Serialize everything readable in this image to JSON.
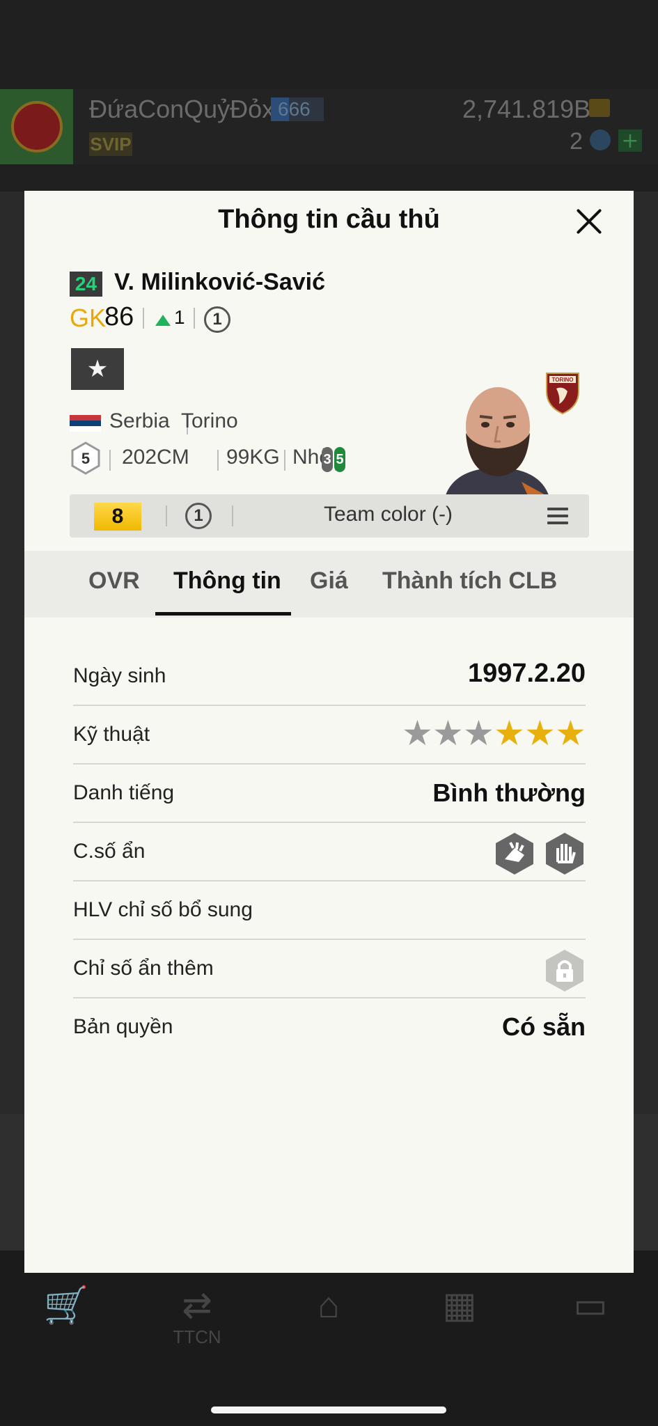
{
  "background": {
    "user_name": "ĐứaConQuỷĐỏx",
    "level": "666",
    "vip": "SVIP",
    "money": "2,741.819B",
    "coins": "2",
    "plus": "+",
    "nav_label": "TTCN"
  },
  "modal": {
    "title": "Thông tin cầu thủ",
    "player": {
      "number": "24",
      "name": "V. Milinković-Savić",
      "position": "GK",
      "ovr": "86",
      "change": "1",
      "circle": "1",
      "fav_icon": "★",
      "nation": "Serbia",
      "club": "Torino",
      "weak_foot": "5",
      "height": "202CM",
      "weight": "99KG",
      "body": "Nhỏ",
      "foot_left": "3",
      "foot_right": "5"
    },
    "action_bar": {
      "level": "8",
      "circle": "1",
      "team_color": "Team color (-)"
    },
    "tabs": [
      "OVR",
      "Thông tin",
      "Giá",
      "Thành tích CLB"
    ],
    "active_tab": "Thông tin",
    "rows": {
      "birth_label": "Ngày sinh",
      "birth_value": "1997.2.20",
      "skill_label": "Kỹ thuật",
      "skill_stars": 3,
      "skill_max": 6,
      "rep_label": "Danh tiếng",
      "rep_value": "Bình thường",
      "hidden_label": "C.số ẩn",
      "coach_label": "HLV chỉ số bổ sung",
      "extra_label": "Chỉ số ẩn thêm",
      "license_label": "Bản quyền",
      "license_value": "Có sẵn"
    }
  },
  "colors": {
    "star_on": "#e8b00c",
    "star_off": "#9a9a9a",
    "gk": "#e8a80c",
    "green": "#1fb35c"
  }
}
